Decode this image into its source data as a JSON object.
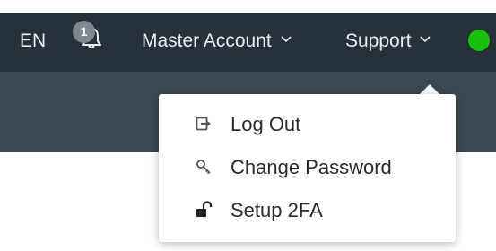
{
  "header": {
    "language": "EN",
    "notifications": {
      "count": "1",
      "icon": "bell-icon"
    },
    "master_account": {
      "label": "Master Account",
      "icon": "chevron-down-icon"
    },
    "support": {
      "label": "Support",
      "icon": "chevron-down-icon"
    },
    "status": {
      "color": "#19c10f"
    }
  },
  "dropdown": {
    "items": [
      {
        "label": "Log Out",
        "icon": "logout-icon"
      },
      {
        "label": "Change Password",
        "icon": "key-icon"
      },
      {
        "label": "Setup 2FA",
        "icon": "unlock-icon"
      }
    ]
  },
  "colors": {
    "topbar": "#27313b",
    "subbar": "#3b4752",
    "badge": "#7f8890",
    "status_online": "#19c10f"
  }
}
